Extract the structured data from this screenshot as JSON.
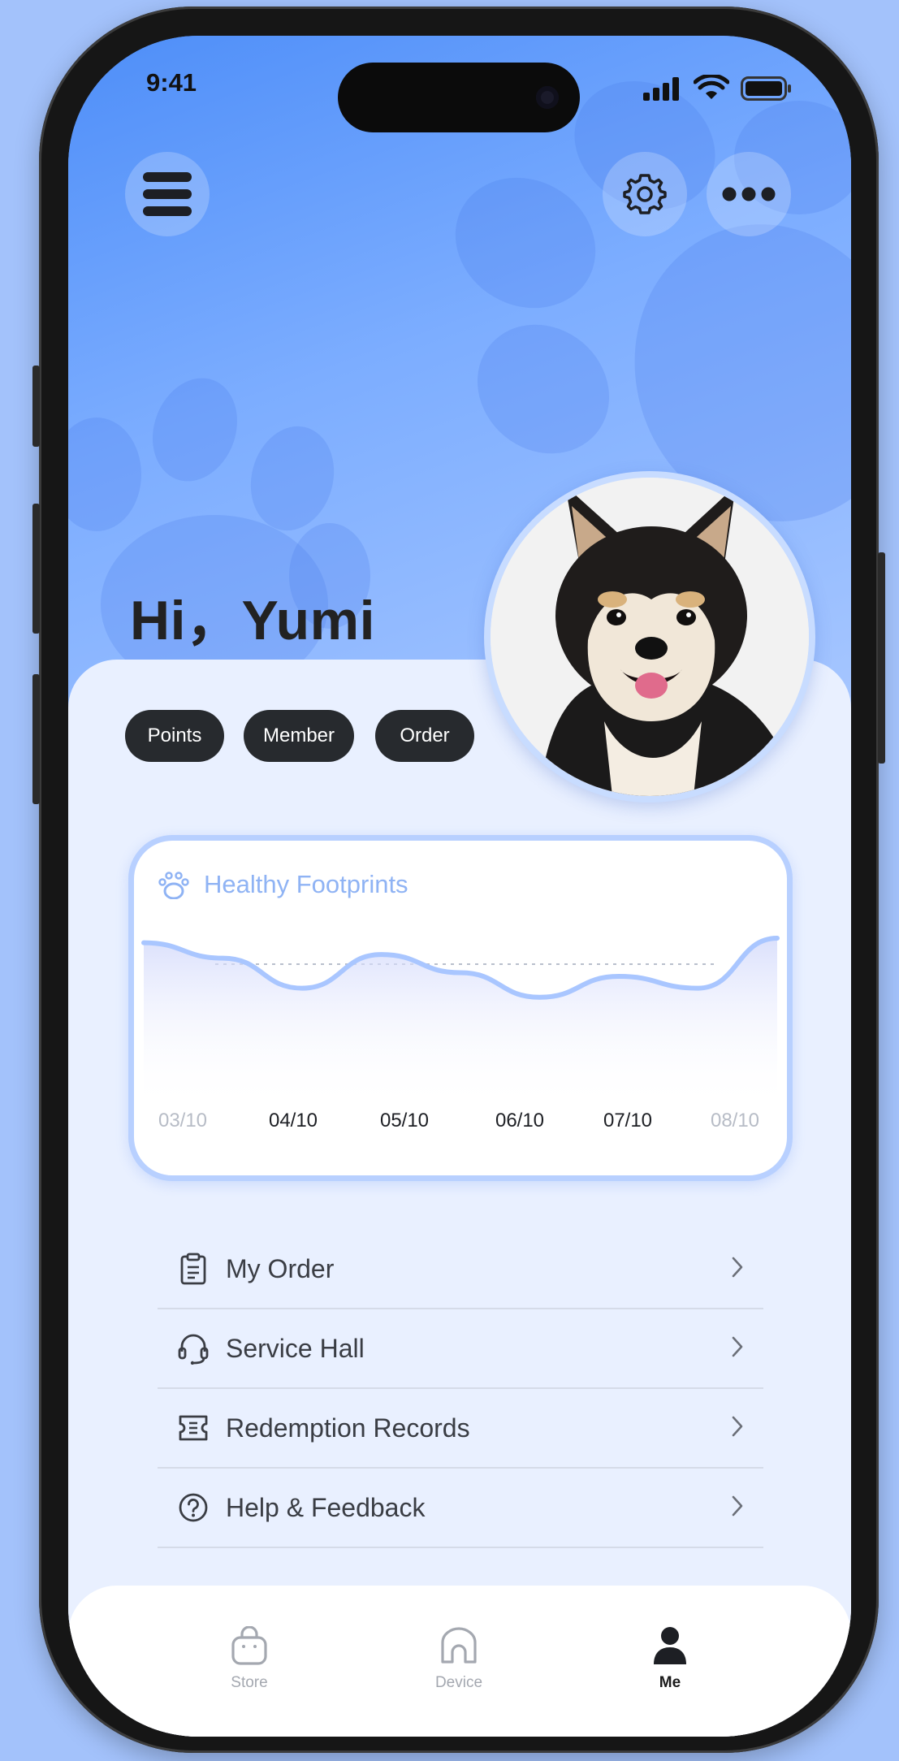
{
  "status_bar": {
    "time": "9:41"
  },
  "header": {
    "greeting": "Hi，Yumi"
  },
  "pills": [
    {
      "label": "Points"
    },
    {
      "label": "Member"
    },
    {
      "label": "Order"
    }
  ],
  "chart_card": {
    "title": "Healthy Footprints",
    "chart_data": {
      "type": "area",
      "x": [
        "03/10",
        "04/10",
        "05/10",
        "06/10",
        "07/10",
        "08/10"
      ],
      "series": [
        {
          "values": [
            0.95,
            0.78,
            0.45,
            0.82,
            0.62,
            0.35,
            0.58,
            0.45,
            1.0
          ]
        }
      ],
      "reference_line": "dashed"
    }
  },
  "menu": {
    "items": [
      {
        "label": "My Order",
        "icon": "clipboard-icon"
      },
      {
        "label": "Service Hall",
        "icon": "headset-icon"
      },
      {
        "label": "Redemption Records",
        "icon": "ticket-icon"
      },
      {
        "label": "Help & Feedback",
        "icon": "question-icon"
      }
    ]
  },
  "tabbar": {
    "tabs": [
      {
        "label": "Store",
        "icon": "bag-icon",
        "active": false
      },
      {
        "label": "Device",
        "icon": "home-icon",
        "active": false
      },
      {
        "label": "Me",
        "icon": "person-icon",
        "active": true
      }
    ]
  },
  "colors": {
    "accent": "#5e98fb",
    "pill": "#272a2e",
    "chart_line": "#a9c6ff"
  }
}
